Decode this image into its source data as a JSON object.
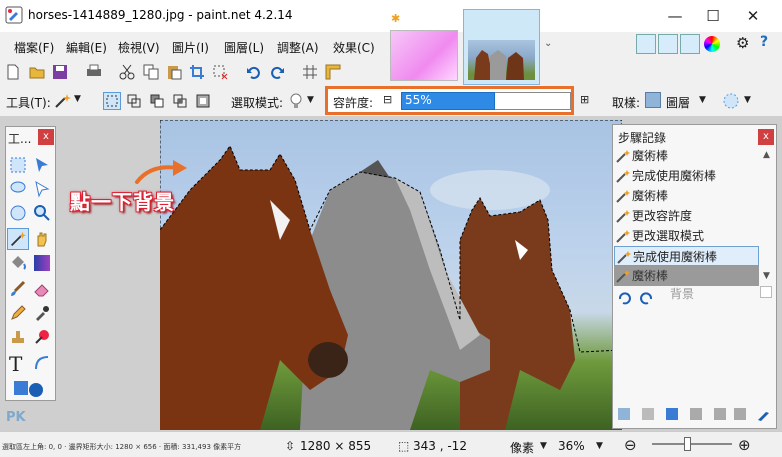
{
  "window": {
    "title": "horses-1414889_1280.jpg - paint.net 4.2.14",
    "controls": {
      "minimize": "—",
      "maximize": "☐",
      "close": "✕"
    }
  },
  "menu": [
    "檔案(F)",
    "編輯(E)",
    "檢視(V)",
    "圖片(I)",
    "圖層(L)",
    "調整(A)",
    "效果(C)"
  ],
  "toolbar2": {
    "tool_label": "工具(T):",
    "selection_mode_label": "選取模式:",
    "tolerance_label": "容許度:",
    "tolerance_value": "55%",
    "tolerance_fraction": 0.55,
    "sampling_label": "取樣:",
    "sampling_value": "圖層"
  },
  "tools_panel": {
    "title": "工...",
    "close": "x"
  },
  "history_panel": {
    "title": "步驟記錄",
    "close": "x",
    "items": [
      "魔術棒",
      "完成使用魔術棒",
      "魔術棒",
      "更改容許度",
      "更改選取模式",
      "完成使用魔術棒",
      "魔術棒",
      "背景"
    ]
  },
  "annotation": {
    "text": "點一下背景",
    "color": "#e8702a"
  },
  "status": {
    "hint": "選取區左上角: 0, 0 · 邊界矩形大小: 1280 × 656 · 面積: 331,493 像素平方",
    "image_size": "1280 × 855",
    "cursor": "343 , -12",
    "units": "像素",
    "zoom": "36%"
  },
  "watermark": "PK",
  "colors": {
    "accent": "#2f8ae6",
    "highlight_box": "#e8702a",
    "close": "#d04040"
  }
}
